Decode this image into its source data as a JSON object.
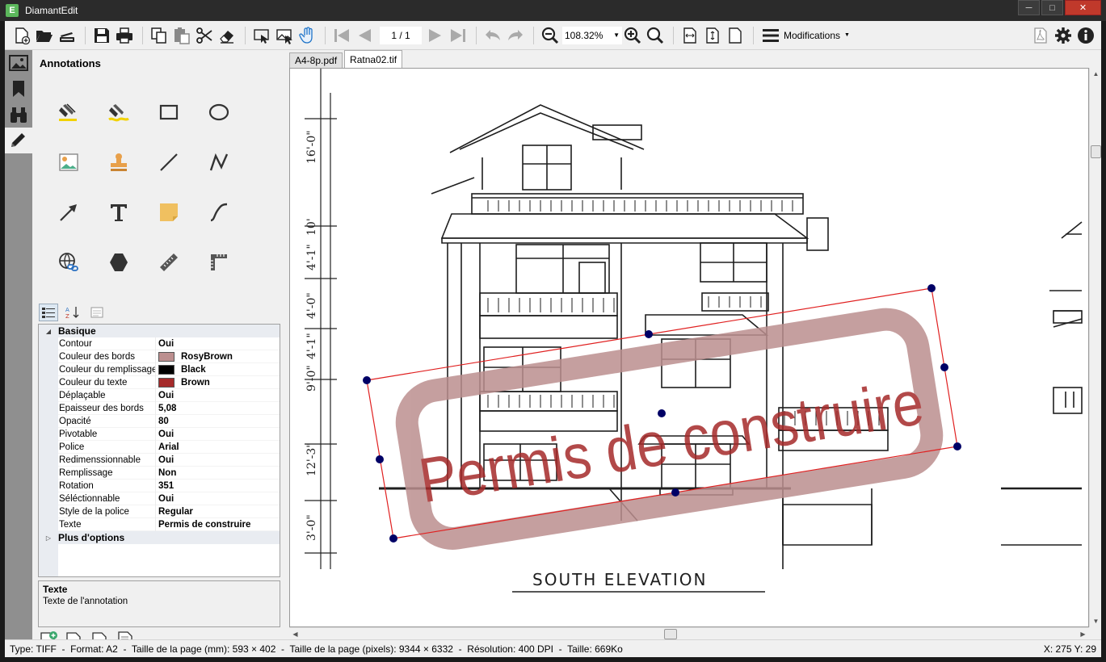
{
  "window": {
    "title": "DiamantEdit",
    "app_letter": "E"
  },
  "toolbar": {
    "page_indicator": "1 / 1",
    "zoom": "108.32%",
    "modifications_label": "Modifications"
  },
  "panel": {
    "title": "Annotations",
    "tools": [
      "highlighter",
      "free-highlighter",
      "rectangle",
      "ellipse",
      "image",
      "stamp",
      "line",
      "polyline",
      "arrow",
      "text",
      "sticky-note",
      "curve",
      "link",
      "polygon",
      "ruler",
      "angle"
    ]
  },
  "properties": {
    "group_basic": "Basique",
    "rows": [
      {
        "name": "Contour",
        "value": "Oui"
      },
      {
        "name": "Couleur des bords",
        "value": "RosyBrown",
        "swatch": "#bc8f8f"
      },
      {
        "name": "Couleur du remplissage",
        "value": "Black",
        "swatch": "#000000"
      },
      {
        "name": "Couleur du texte",
        "value": "Brown",
        "swatch": "#a52a2a"
      },
      {
        "name": "Déplaçable",
        "value": "Oui"
      },
      {
        "name": "Epaisseur des bords",
        "value": "5,08"
      },
      {
        "name": "Opacité",
        "value": "80"
      },
      {
        "name": "Pivotable",
        "value": "Oui"
      },
      {
        "name": "Police",
        "value": "Arial"
      },
      {
        "name": "Redimenssionnable",
        "value": "Oui"
      },
      {
        "name": "Remplissage",
        "value": "Non"
      },
      {
        "name": "Rotation",
        "value": "351"
      },
      {
        "name": "Séléctionnable",
        "value": "Oui"
      },
      {
        "name": "Style de la police",
        "value": "Regular"
      },
      {
        "name": "Texte",
        "value": "Permis de construire"
      }
    ],
    "group_more": "Plus d'options"
  },
  "description": {
    "title": "Texte",
    "text": "Texte de l'annotation"
  },
  "tabs": [
    {
      "label": "A4-8p.pdf",
      "active": false
    },
    {
      "label": "Ratna02.tif",
      "active": true
    }
  ],
  "document": {
    "elevation_label": "SOUTH ELEVATION",
    "stamp_text": "Permis de construire",
    "stamp_color": "#a52a2a",
    "stamp_border_color": "#bc8f8f",
    "stamp_rotation_deg": 351,
    "dimension_labels": [
      "16'-0\"",
      "10'",
      "4'-1\"",
      "4'-0\"",
      "4'-1\"",
      "9'-0\"",
      "12'-3\"",
      "3'-0\""
    ]
  },
  "status": {
    "info": "Type: TIFF  -  Format: A2  -  Taille de la page (mm): 593 × 402  -  Taille de la page (pixels): 9344 × 6332  -  Résolution: 400 DPI  -  Taille: 669Ko",
    "coords": "X: 275 Y: 29"
  },
  "colors": {
    "titlebar": "#2b2b2b",
    "strip": "#8f8f8f",
    "panel": "#f0f0f0",
    "selection": "#000066"
  }
}
